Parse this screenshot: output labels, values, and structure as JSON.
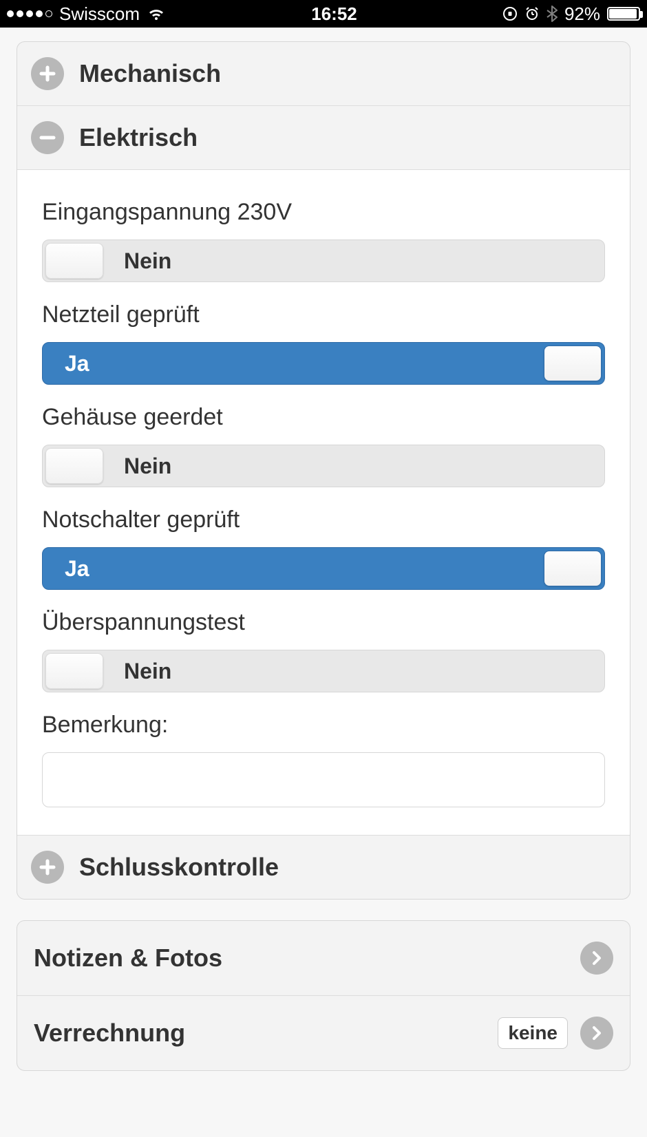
{
  "status": {
    "carrier": "Swisscom",
    "time": "16:52",
    "battery_pct": "92%"
  },
  "sections": {
    "mechanisch": {
      "label": "Mechanisch"
    },
    "elektrisch": {
      "label": "Elektrisch",
      "items": [
        {
          "label": "Eingangspannung 230V",
          "on": false,
          "on_text": "Ja",
          "off_text": "Nein"
        },
        {
          "label": "Netzteil geprüft",
          "on": true,
          "on_text": "Ja",
          "off_text": "Nein"
        },
        {
          "label": "Gehäuse geerdet",
          "on": false,
          "on_text": "Ja",
          "off_text": "Nein"
        },
        {
          "label": "Notschalter geprüft",
          "on": true,
          "on_text": "Ja",
          "off_text": "Nein"
        },
        {
          "label": "Überspannungstest",
          "on": false,
          "on_text": "Ja",
          "off_text": "Nein"
        }
      ],
      "remark_label": "Bemerkung:",
      "remark_value": ""
    },
    "schlusskontrolle": {
      "label": "Schlusskontrolle"
    }
  },
  "rows": {
    "notes": {
      "label": "Notizen & Fotos"
    },
    "billing": {
      "label": "Verrechnung",
      "value": "keine"
    }
  }
}
